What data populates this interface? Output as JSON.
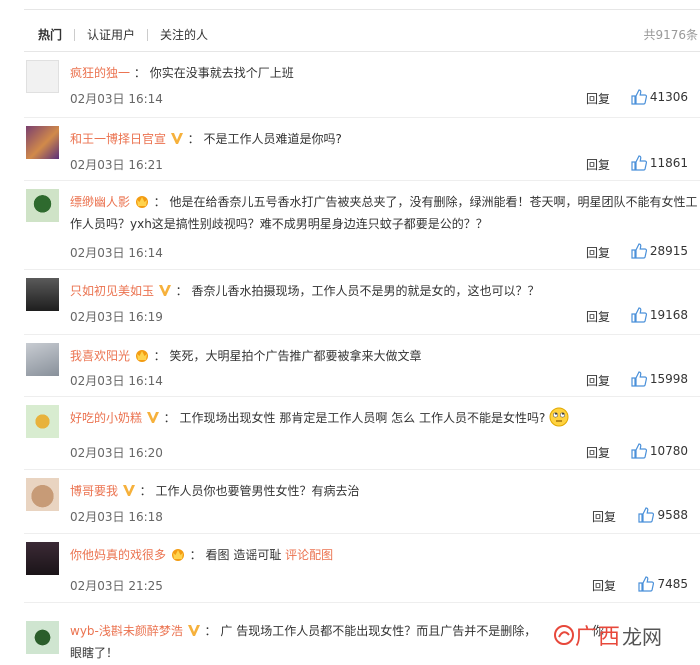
{
  "tabs": [
    {
      "label": "热门",
      "active": true
    },
    {
      "label": "认证用户",
      "active": false
    },
    {
      "label": "关注的人",
      "active": false
    }
  ],
  "total_count": "共9176条",
  "reply_label": "回复",
  "comments": [
    {
      "user": "疯狂的独一",
      "badge": "",
      "sep": "：",
      "text": "你实在没事就去找个厂上班",
      "date": "02月03日 16:14",
      "likes": "41306",
      "avatar": "av-a"
    },
    {
      "user": "和王一博择日官宣",
      "badge": "vip",
      "sep": "：",
      "text": "不是工作人员难道是你吗?",
      "date": "02月03日 16:21",
      "likes": "11861",
      "avatar": "av-b"
    },
    {
      "user": "缥缈幽人影",
      "badge": "crown",
      "sep": "：",
      "text": "他是在给香奈儿五号香水打广告被夹总夹了，没有删除，绿洲能看！苍天啊，明星团队不能有女性工作人员吗？yxh这是搞性别歧视吗？难不成男明星身边连只蚊子都要是公的？？",
      "date": "02月03日 16:14",
      "likes": "28915",
      "avatar": "av-c"
    },
    {
      "user": "只如初见美如玉",
      "badge": "vip",
      "sep": "：",
      "text": "香奈儿香水拍摄现场，工作人员不是男的就是女的，这也可以？？",
      "date": "02月03日 16:19",
      "likes": "19168",
      "avatar": "av-d"
    },
    {
      "user": "我喜欢阳光",
      "badge": "crown",
      "sep": "：",
      "text": "笑死，大明星拍个广告推广都要被拿来大做文章",
      "date": "02月03日 16:14",
      "likes": "15998",
      "avatar": "av-e"
    },
    {
      "user": "好吃的小奶糕",
      "badge": "vip",
      "sep": "：",
      "text": "工作现场出现女性 那肯定是工作人员啊 怎么 工作人员不能是女性吗?",
      "date": "02月03日 16:20",
      "likes": "10780",
      "avatar": "av-f"
    },
    {
      "user": "博哥要我",
      "badge": "vip",
      "sep": "：",
      "text": "工作人员你也要管男性女性？有病去治",
      "date": "02月03日 16:18",
      "likes": "9588",
      "avatar": "av-g"
    },
    {
      "user": "你他妈真的戏很多",
      "badge": "crown",
      "sep": "：",
      "text": "看图 造谣可耻 ",
      "link": "评论配图",
      "date": "02月03日 21:25",
      "likes": "7485",
      "avatar": "av-h"
    },
    {
      "user": "wyb-浅斟未颜醉梦浩",
      "badge": "vip",
      "sep": "：",
      "text": "广 告现场工作人员都不能出现女性？而且广告并不是删除，",
      "text_end": "你",
      "text2": "眼瞎了！",
      "avatar": "av-i"
    }
  ],
  "watermark": {
    "brand": "广西",
    "brand2": "龙网"
  }
}
